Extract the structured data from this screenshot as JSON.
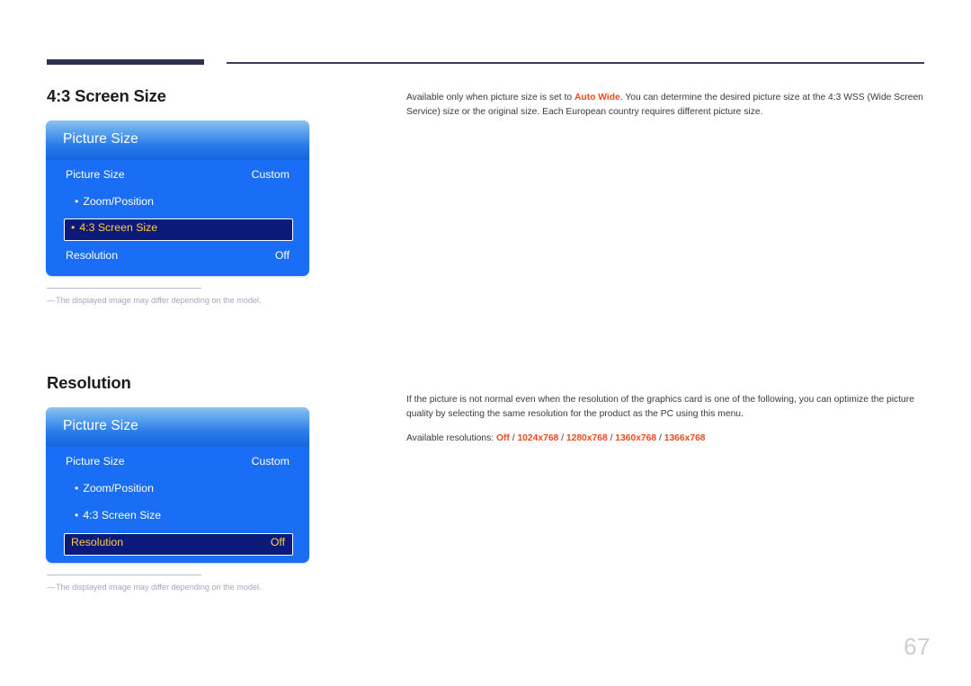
{
  "page": {
    "number": "67",
    "accent_color": "#ec4a1e",
    "panel_blue": "#1a6ef5",
    "highlight_navy": "#0b1a7a",
    "highlight_gold": "#ffcf3f"
  },
  "sections": [
    {
      "title": "4:3 Screen Size",
      "panel": {
        "header_title": "Picture Size",
        "rows": [
          {
            "label": "Picture Size",
            "value": "Custom",
            "bullet": false,
            "selected": false
          },
          {
            "label": "Zoom/Position",
            "value": "",
            "bullet": true,
            "selected": false
          },
          {
            "label": "4:3 Screen Size",
            "value": "",
            "bullet": true,
            "selected": true
          },
          {
            "label": "Resolution",
            "value": "Off",
            "bullet": false,
            "selected": false
          }
        ]
      },
      "footnote": "The displayed image may differ depending on the model.",
      "footnote_dash": "―",
      "description": {
        "paragraph_1_before": "Available only when picture size is set to ",
        "paragraph_1_accent": "Auto Wide",
        "paragraph_1_after": ". You can determine the desired picture size at the 4:3 WSS (Wide Screen Service) size or the original size. Each European country requires different picture size."
      }
    },
    {
      "title": "Resolution",
      "panel": {
        "header_title": "Picture Size",
        "rows": [
          {
            "label": "Picture Size",
            "value": "Custom",
            "bullet": false,
            "selected": false
          },
          {
            "label": "Zoom/Position",
            "value": "",
            "bullet": true,
            "selected": false
          },
          {
            "label": "4:3 Screen Size",
            "value": "",
            "bullet": true,
            "selected": false
          },
          {
            "label": "Resolution",
            "value": "Off",
            "bullet": false,
            "selected": true
          }
        ]
      },
      "footnote": "The displayed image may differ depending on the model.",
      "footnote_dash": "―",
      "description": {
        "paragraph_1": "If the picture is not normal even when the resolution of the graphics card is one of the following, you can optimize the picture quality by selecting the same resolution for the product as the PC using this menu.",
        "resolutions_label": "Available resolutions: ",
        "resolutions": [
          "Off",
          "1024x768",
          "1280x768",
          "1360x768",
          "1366x768"
        ],
        "resolutions_separator": " / "
      }
    }
  ]
}
